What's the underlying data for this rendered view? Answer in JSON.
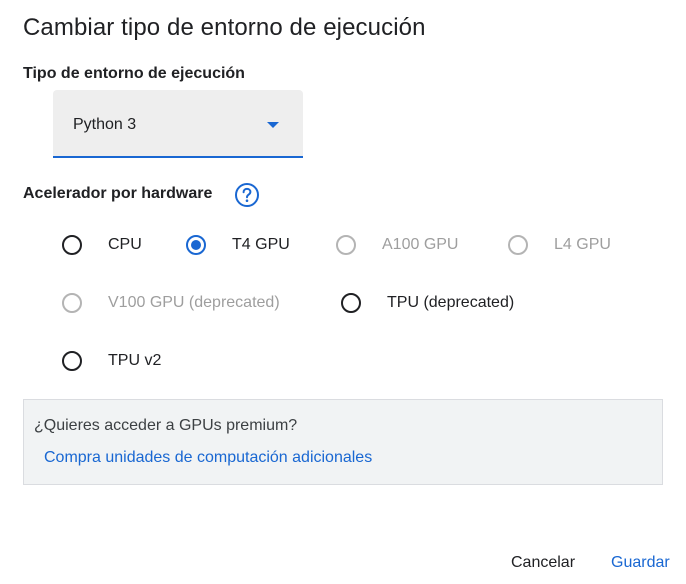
{
  "dialog": {
    "title": "Cambiar tipo de entorno de ejecución"
  },
  "runtime": {
    "label": "Tipo de entorno de ejecución",
    "selected": "Python 3"
  },
  "accelerator": {
    "label": "Acelerador por hardware",
    "help_icon": "help-circle-icon",
    "selected": "T4 GPU",
    "options": [
      {
        "label": "CPU",
        "state": "enabled"
      },
      {
        "label": "T4 GPU",
        "state": "selected"
      },
      {
        "label": "A100 GPU",
        "state": "disabled"
      },
      {
        "label": "L4 GPU",
        "state": "disabled"
      },
      {
        "label": "V100 GPU (deprecated)",
        "state": "disabled"
      },
      {
        "label": "TPU (deprecated)",
        "state": "enabled"
      },
      {
        "label": "TPU v2",
        "state": "enabled"
      }
    ]
  },
  "promo": {
    "question": "¿Quieres acceder a GPUs premium?",
    "link": "Compra unidades de computación adicionales"
  },
  "actions": {
    "cancel": "Cancelar",
    "save": "Guardar"
  },
  "colors": {
    "accent": "#1967d2",
    "text": "#202124",
    "disabled": "#9e9e9e",
    "select_bg": "#eeeeee",
    "promo_bg": "#f1f3f4"
  }
}
